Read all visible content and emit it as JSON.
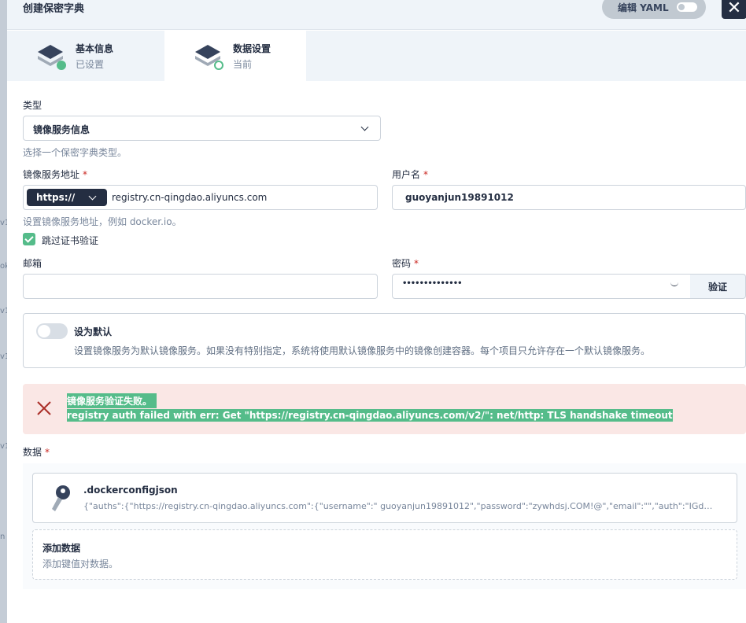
{
  "header": {
    "title": "创建保密字典",
    "yaml_label": "编辑 YAML",
    "close_glyph": "✕"
  },
  "background_labels": [
    "v1",
    "ok",
    "v1",
    "v1",
    "v1",
    "n"
  ],
  "tabs": [
    {
      "title": "基本信息",
      "subtitle": "已设置"
    },
    {
      "title": "数据设置",
      "subtitle": "当前"
    }
  ],
  "form": {
    "type": {
      "label": "类型",
      "value": "镜像服务信息",
      "hint": "选择一个保密字典类型。"
    },
    "registry": {
      "label": "镜像服务地址",
      "required": "*",
      "protocol": "https://",
      "value": "registry.cn-qingdao.aliyuncs.com",
      "hint": "设置镜像服务地址，例如 docker.io。"
    },
    "username": {
      "label": "用户名",
      "required": "*",
      "value": "guoyanjun19891012"
    },
    "skip_tls": {
      "label": "跳过证书验证",
      "checked": true
    },
    "email": {
      "label": "邮箱",
      "value": ""
    },
    "password": {
      "label": "密码",
      "required": "*",
      "masked": "••••••••••••••",
      "verify_label": "验证"
    },
    "default": {
      "title": "设为默认",
      "description": "设置镜像服务为默认镜像服务。如果没有特别指定，系统将使用默认镜像服务中的镜像创建容器。每个项目只允许存在一个默认镜像服务。",
      "enabled": false
    }
  },
  "error": {
    "title": "镜像服务验证失败。",
    "message": "registry auth failed with err: Get \"https://registry.cn-qingdao.aliyuncs.com/v2/\": net/http: TLS handshake timeout"
  },
  "data": {
    "label": "数据",
    "required": "*",
    "items": [
      {
        "key": ".dockerconfigjson",
        "value": "{\"auths\":{\"https://registry.cn-qingdao.aliyuncs.com\":{\"username\":\" guoyanjun19891012\",\"password\":\"zywhdsj.COM!@\",\"email\":\"\",\"auth\":\"IGd1b3lhbmp1..."
      }
    ],
    "add": {
      "title": "添加数据",
      "subtitle": "添加键值对数据。"
    }
  },
  "colors": {
    "primary_dark": "#242e42",
    "success_green": "#55bc8a",
    "error_red": "#ca2621",
    "error_bg": "#fae7e5",
    "header_bg": "#eff4f9"
  }
}
